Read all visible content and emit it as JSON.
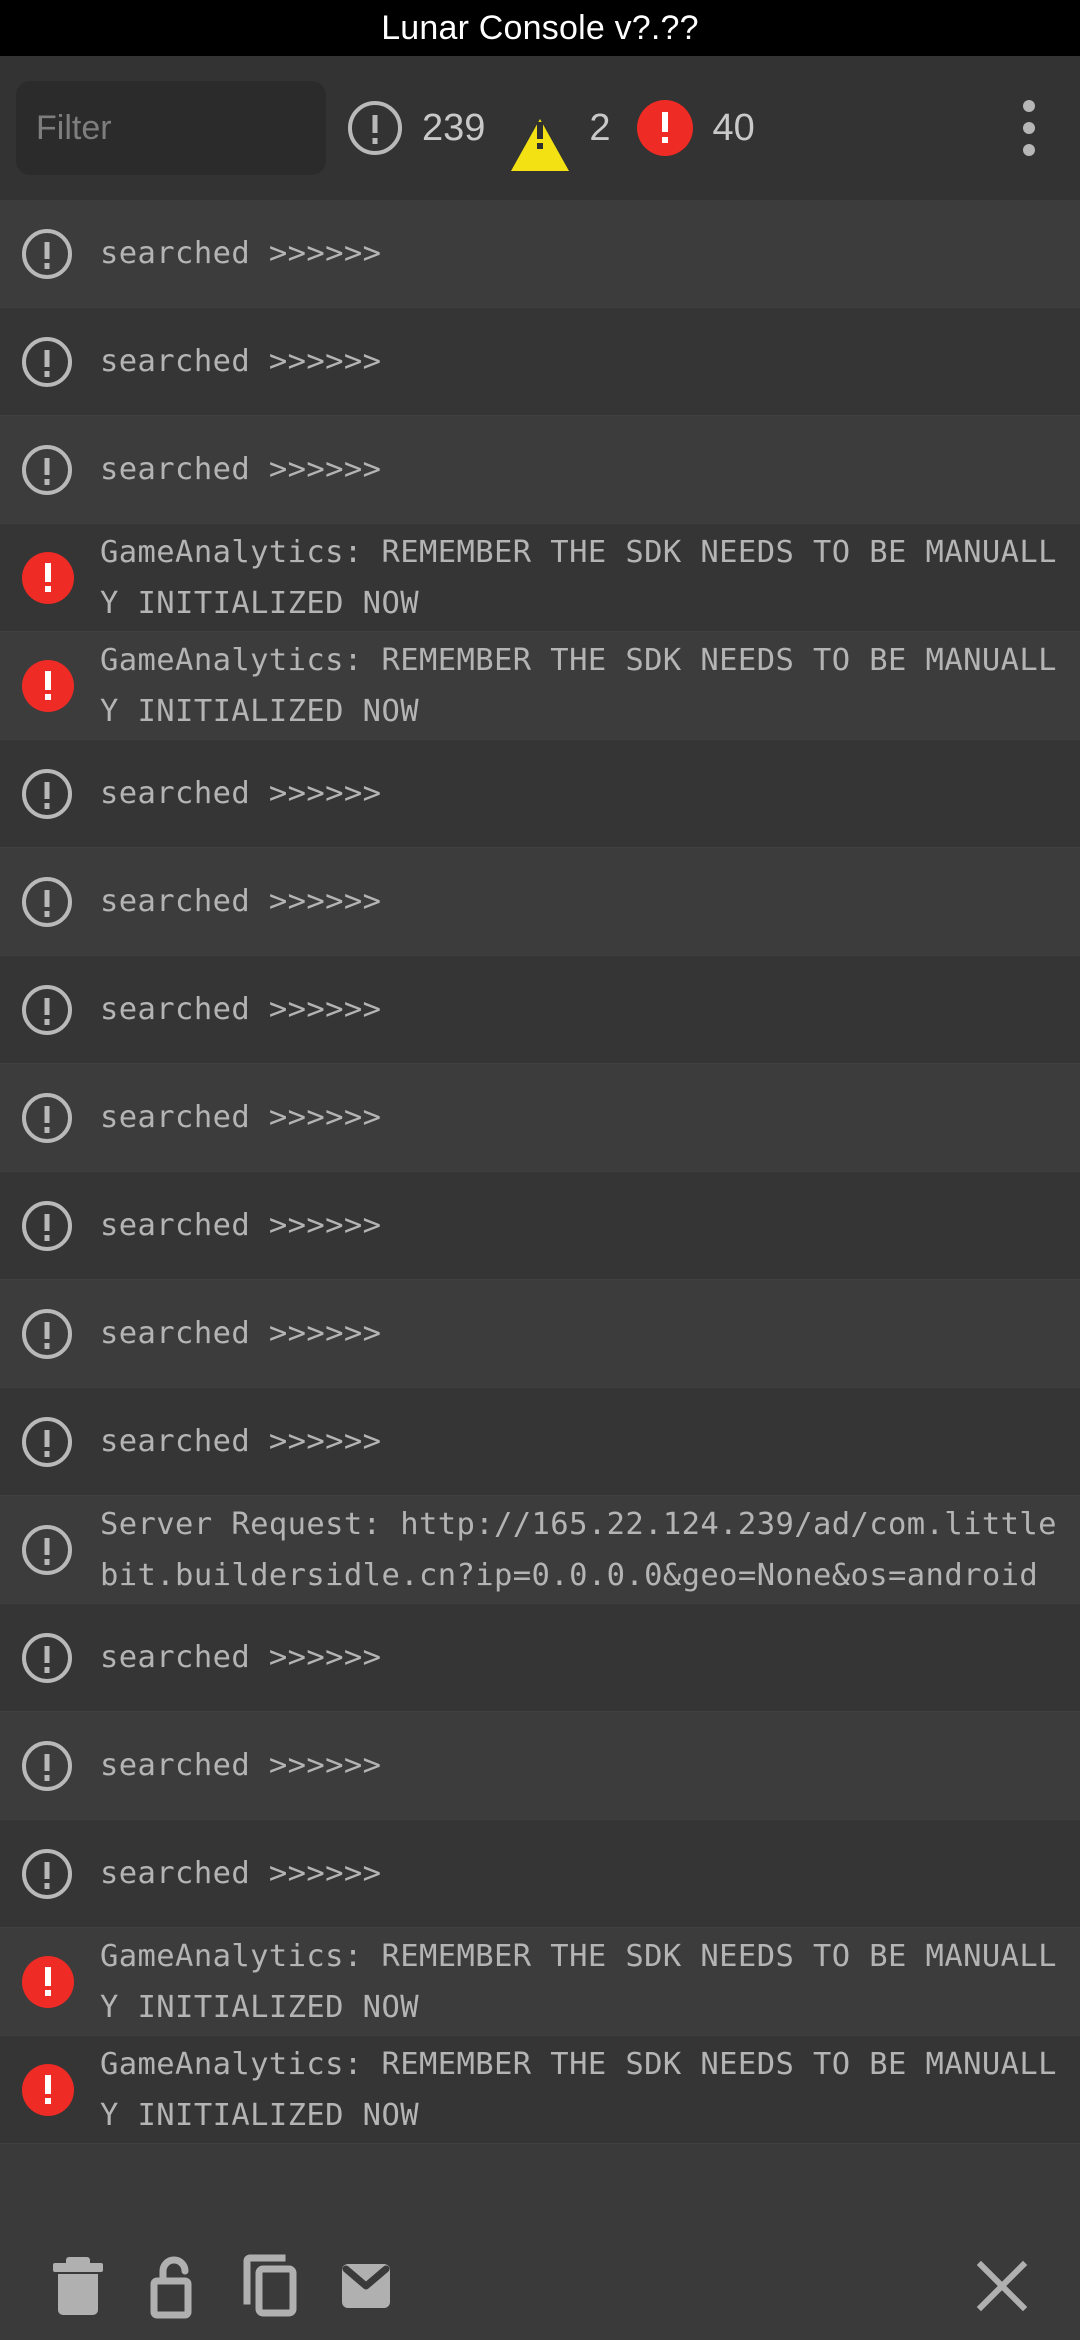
{
  "window": {
    "title": "Lunar Console v?.??"
  },
  "toolbar": {
    "filter_placeholder": "Filter",
    "filter_value": "",
    "counters": [
      {
        "icon": "info-icon",
        "name": "log-count",
        "value": "239"
      },
      {
        "icon": "warning-icon",
        "name": "warning-count",
        "value": "2"
      },
      {
        "icon": "error-icon",
        "name": "error-count",
        "value": "40"
      }
    ],
    "overflow_menu": "more-options"
  },
  "colors": {
    "titlebar_bg": "#000000",
    "toolbar_bg": "#333333",
    "list_bg": "#3a3a3a",
    "row_alt_bg": "#353535",
    "text": "#b4b4b4",
    "warning": "#F4E113",
    "error": "#EE2B24",
    "icon": "#b9b9b9"
  },
  "log": {
    "entries": [
      {
        "level": "info",
        "text": "searched >>>>>>"
      },
      {
        "level": "info",
        "text": "searched >>>>>>"
      },
      {
        "level": "info",
        "text": "searched >>>>>>"
      },
      {
        "level": "error",
        "text": "GameAnalytics: REMEMBER THE SDK NEEDS TO BE MANUALLY INITIALIZED NOW"
      },
      {
        "level": "error",
        "text": "GameAnalytics: REMEMBER THE SDK NEEDS TO BE MANUALLY INITIALIZED NOW"
      },
      {
        "level": "info",
        "text": "searched >>>>>>"
      },
      {
        "level": "info",
        "text": "searched >>>>>>"
      },
      {
        "level": "info",
        "text": "searched >>>>>>"
      },
      {
        "level": "info",
        "text": "searched >>>>>>"
      },
      {
        "level": "info",
        "text": "searched >>>>>>"
      },
      {
        "level": "info",
        "text": "searched >>>>>>"
      },
      {
        "level": "info",
        "text": "searched >>>>>>"
      },
      {
        "level": "info",
        "text": "Server Request: http://165.22.124.239/ad/com.littlebit.buildersidle.cn?ip=0.0.0.0&geo=None&os=android"
      },
      {
        "level": "info",
        "text": "searched >>>>>>"
      },
      {
        "level": "info",
        "text": "searched >>>>>>"
      },
      {
        "level": "info",
        "text": "searched >>>>>>"
      },
      {
        "level": "error",
        "text": "GameAnalytics: REMEMBER THE SDK NEEDS TO BE MANUALLY INITIALIZED NOW"
      },
      {
        "level": "error",
        "text": "GameAnalytics: REMEMBER THE SDK NEEDS TO BE MANUALLY INITIALIZED NOW"
      }
    ]
  },
  "bottombar": {
    "actions": [
      {
        "name": "clear-button",
        "icon": "trash-icon"
      },
      {
        "name": "lock-button",
        "icon": "unlock-icon"
      },
      {
        "name": "copy-button",
        "icon": "copy-icon"
      },
      {
        "name": "email-button",
        "icon": "email-icon"
      },
      {
        "name": "close-button",
        "icon": "close-icon"
      }
    ]
  }
}
